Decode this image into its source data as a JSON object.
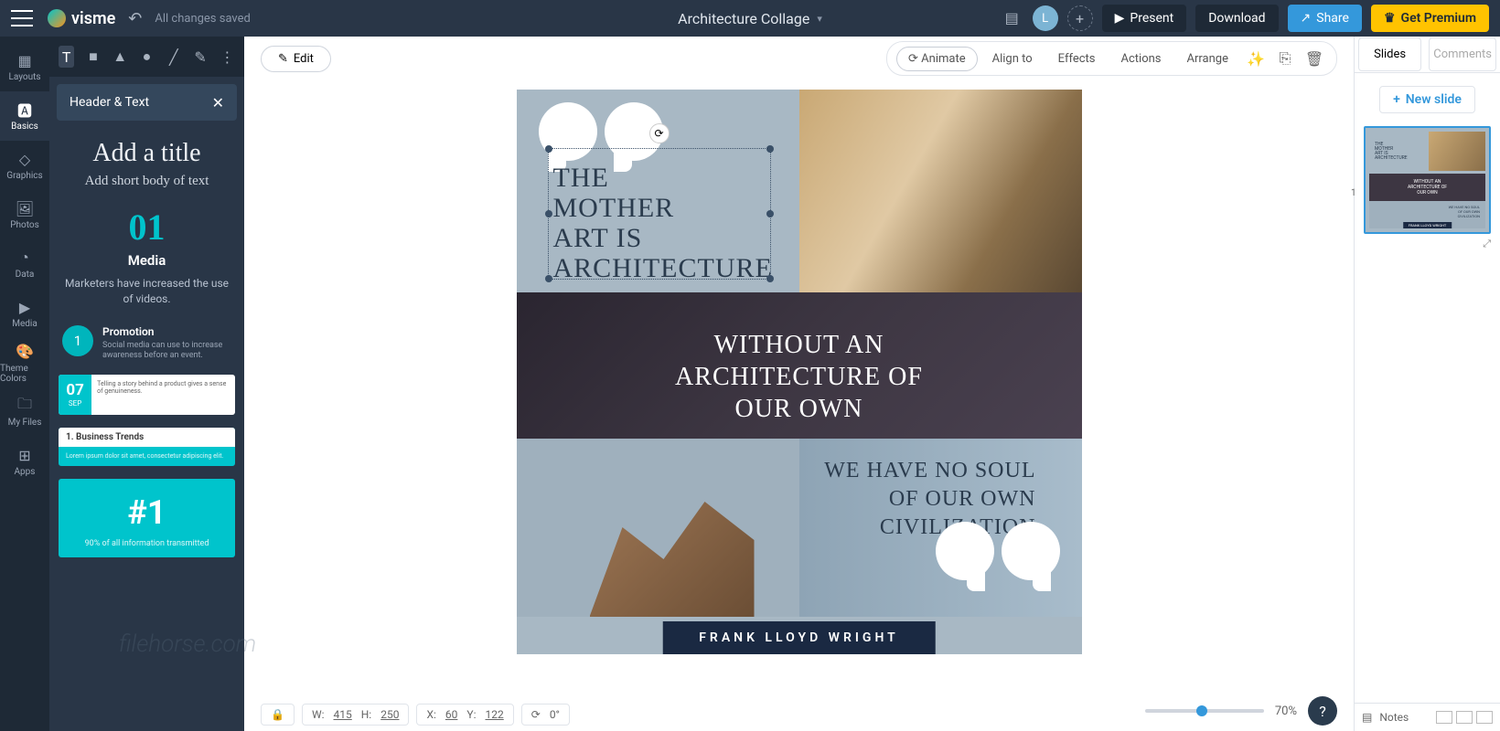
{
  "topbar": {
    "saved": "All changes saved",
    "title": "Architecture Collage",
    "present": "Present",
    "download": "Download",
    "share": "Share",
    "premium": "Get Premium",
    "avatar": "L"
  },
  "leftnav": [
    {
      "label": "Layouts"
    },
    {
      "label": "Basics"
    },
    {
      "label": "Graphics"
    },
    {
      "label": "Photos"
    },
    {
      "label": "Data"
    },
    {
      "label": "Media"
    },
    {
      "label": "Theme Colors"
    },
    {
      "label": "My Files"
    },
    {
      "label": "Apps"
    }
  ],
  "panel": {
    "header": "Header & Text",
    "title": "Add a title",
    "sub": "Add short body of text",
    "num": "01",
    "media": "Media",
    "desc": "Marketers have increased the use of videos.",
    "promo": {
      "title": "Promotion",
      "text": "Social media can use to increase awareness before an event.",
      "badge": "1"
    },
    "date": {
      "day": "07",
      "mon": "SEP",
      "text": "Telling a story behind a product gives a sense of genuineness."
    },
    "trend": {
      "head": "1. Business Trends",
      "body": "Lorem ipsum dolor sit amet, consectetur adipiscing elit."
    },
    "hash": {
      "h": "#1",
      "t": "90% of all information transmitted"
    }
  },
  "toolbar": {
    "edit": "Edit",
    "animate": "Animate",
    "alignto": "Align to",
    "effects": "Effects",
    "actions": "Actions",
    "arrange": "Arrange"
  },
  "slide": {
    "txt1": "THE\nMOTHER\nART IS\nARCHITECTURE",
    "txt2": "WITHOUT AN\nARCHITECTURE OF\nOUR OWN",
    "txt3": "WE HAVE NO SOUL\nOF OUR OWN\nCIVILIZATION",
    "author": "FRANK LLOYD WRIGHT"
  },
  "status": {
    "w_label": "W:",
    "w": "415",
    "h_label": "H:",
    "h": "250",
    "x_label": "X:",
    "x": "60",
    "y_label": "Y:",
    "y": "122",
    "r": "0°"
  },
  "zoom": "70%",
  "right": {
    "tab1": "Slides",
    "tab2": "Comments",
    "new": "New slide",
    "thumb_num": "1",
    "notes": "Notes"
  },
  "watermark": "filehorse.com"
}
